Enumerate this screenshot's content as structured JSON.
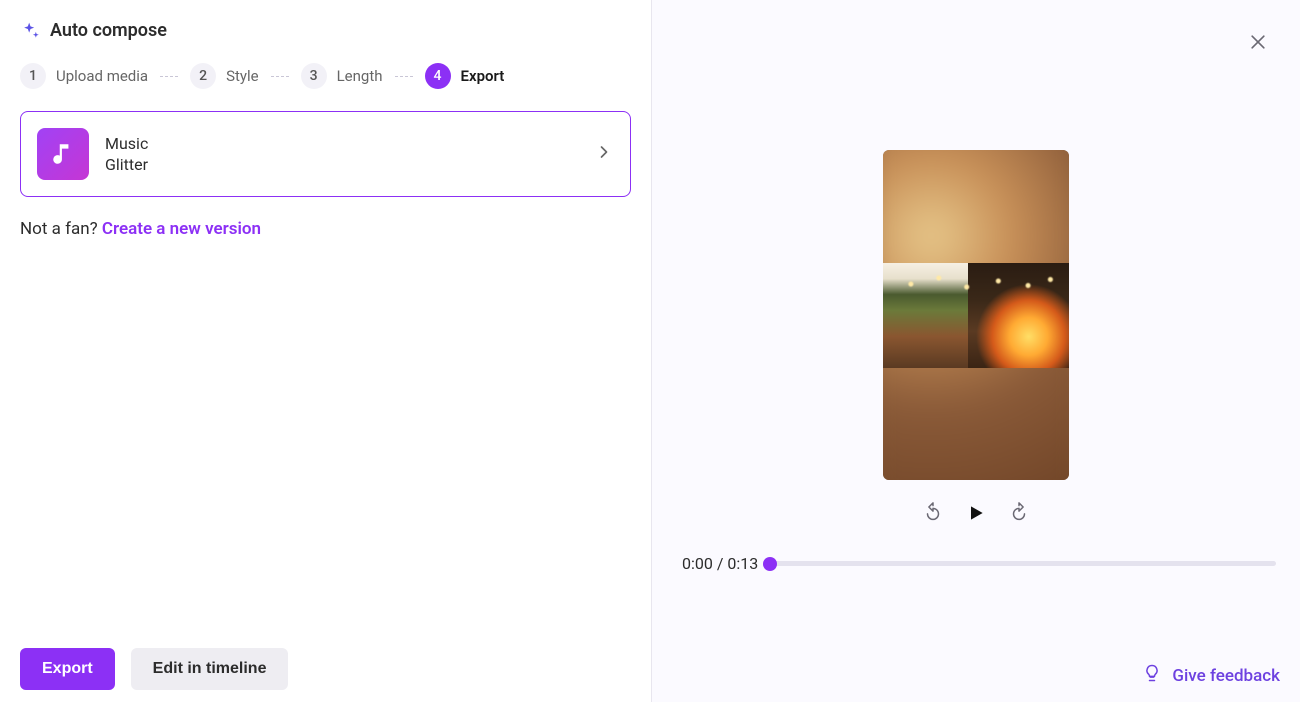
{
  "header": {
    "title": "Auto compose"
  },
  "steps": {
    "items": [
      {
        "num": "1",
        "label": "Upload media"
      },
      {
        "num": "2",
        "label": "Style"
      },
      {
        "num": "3",
        "label": "Length"
      },
      {
        "num": "4",
        "label": "Export"
      }
    ],
    "active_index": 3
  },
  "music_card": {
    "label": "Music",
    "name": "Glitter"
  },
  "not_fan": {
    "text": "Not a fan? ",
    "link": "Create a new version"
  },
  "buttons": {
    "export": "Export",
    "edit_timeline": "Edit in timeline"
  },
  "player": {
    "current": "0:00",
    "separator": " / ",
    "total": "0:13",
    "progress_percent": 0
  },
  "feedback": {
    "label": "Give feedback"
  }
}
